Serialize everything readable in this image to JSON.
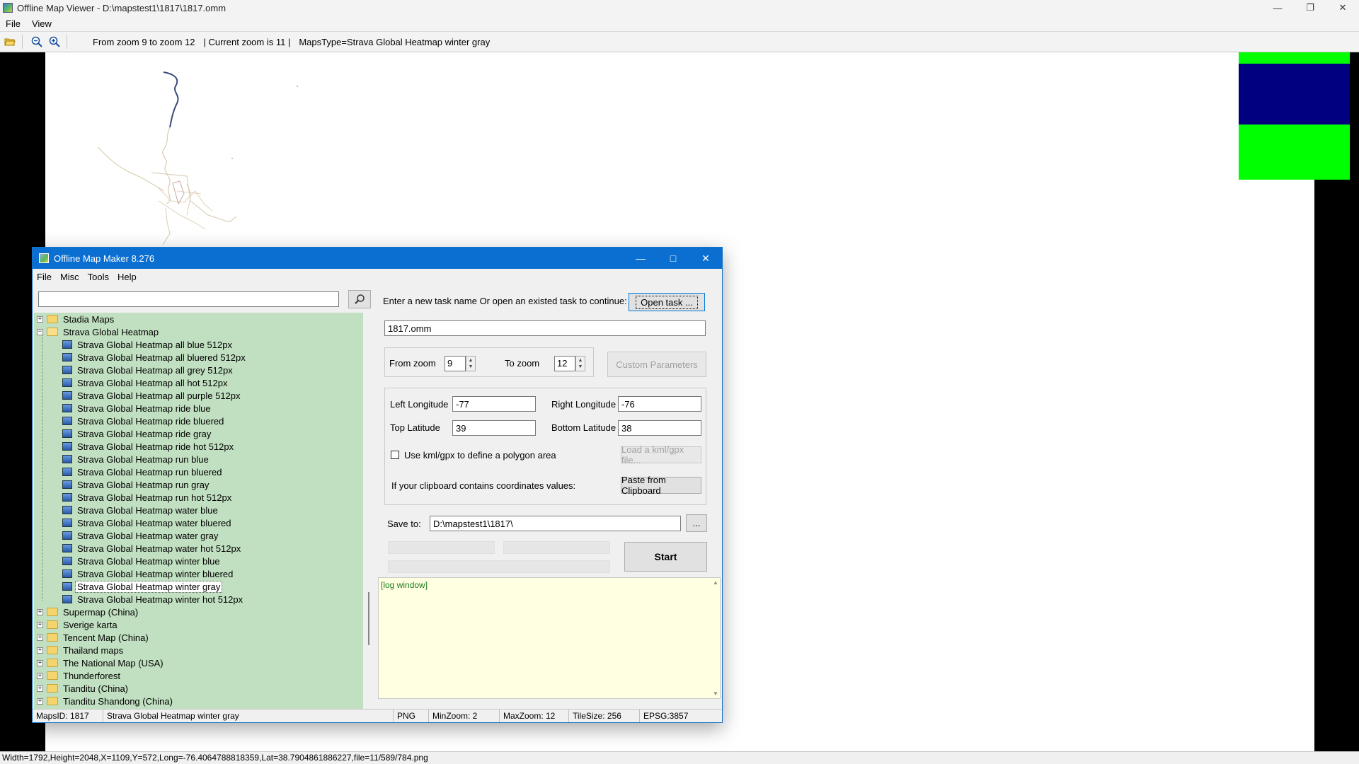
{
  "viewer": {
    "title": "Offline Map Viewer - D:\\mapstest1\\1817\\1817.omm",
    "menu": [
      "File",
      "View"
    ],
    "toolbar": {
      "zoom_range": "From zoom 9 to zoom 12",
      "current_zoom": "|   Current zoom is 11 |",
      "maps_type": "MapsType=Strava Global Heatmap winter gray"
    },
    "status": "Width=1792,Height=2048,X=1109,Y=572,Long=-76.4064788818359,Lat=38.7904861886227,file=11/589/784.png",
    "overview_colors": {
      "green": "#00ff00",
      "navy": "#000080"
    }
  },
  "dialog": {
    "title": "Offline Map Maker 8.276",
    "menu": [
      "File",
      "Misc",
      "Tools",
      "Help"
    ],
    "search": {
      "value": ""
    },
    "tree": [
      {
        "label": "Stadia Maps",
        "type": "folder",
        "expanded": false
      },
      {
        "label": "Strava Global Heatmap",
        "type": "folder",
        "expanded": true
      },
      {
        "label": "Strava Global Heatmap all blue 512px",
        "type": "leaf"
      },
      {
        "label": "Strava Global Heatmap all bluered 512px",
        "type": "leaf"
      },
      {
        "label": "Strava Global Heatmap all grey 512px",
        "type": "leaf"
      },
      {
        "label": "Strava Global Heatmap all hot 512px",
        "type": "leaf"
      },
      {
        "label": "Strava Global Heatmap all purple 512px",
        "type": "leaf"
      },
      {
        "label": "Strava Global Heatmap ride blue",
        "type": "leaf"
      },
      {
        "label": "Strava Global Heatmap ride bluered",
        "type": "leaf"
      },
      {
        "label": "Strava Global Heatmap ride gray",
        "type": "leaf"
      },
      {
        "label": "Strava Global Heatmap ride hot 512px",
        "type": "leaf"
      },
      {
        "label": "Strava Global Heatmap run blue",
        "type": "leaf"
      },
      {
        "label": "Strava Global Heatmap run bluered",
        "type": "leaf"
      },
      {
        "label": "Strava Global Heatmap run gray",
        "type": "leaf"
      },
      {
        "label": "Strava Global Heatmap run hot 512px",
        "type": "leaf"
      },
      {
        "label": "Strava Global Heatmap water blue",
        "type": "leaf"
      },
      {
        "label": "Strava Global Heatmap water bluered",
        "type": "leaf"
      },
      {
        "label": "Strava Global Heatmap water gray",
        "type": "leaf"
      },
      {
        "label": "Strava Global Heatmap water hot 512px",
        "type": "leaf"
      },
      {
        "label": "Strava Global Heatmap winter blue",
        "type": "leaf"
      },
      {
        "label": "Strava Global Heatmap winter bluered",
        "type": "leaf"
      },
      {
        "label": "Strava Global Heatmap winter gray",
        "type": "leaf",
        "selected": true
      },
      {
        "label": "Strava Global Heatmap winter hot 512px",
        "type": "leaf"
      },
      {
        "label": "Supermap (China)",
        "type": "folder",
        "expanded": false
      },
      {
        "label": "Sverige karta",
        "type": "folder",
        "expanded": false
      },
      {
        "label": "Tencent Map (China)",
        "type": "folder",
        "expanded": false
      },
      {
        "label": "Thailand maps",
        "type": "folder",
        "expanded": false
      },
      {
        "label": "The National Map (USA)",
        "type": "folder",
        "expanded": false
      },
      {
        "label": "Thunderforest",
        "type": "folder",
        "expanded": false
      },
      {
        "label": "Tianditu (China)",
        "type": "folder",
        "expanded": false
      },
      {
        "label": "Tianditu Shandong (China)",
        "type": "folder",
        "expanded": false
      }
    ],
    "task": {
      "prompt": "Enter a new task name Or open an existed task to continue:",
      "open_button": "Open task ...",
      "name_value": "1817.omm"
    },
    "zoom": {
      "from_label": "From zoom",
      "from_value": "9",
      "to_label": "To zoom",
      "to_value": "12",
      "custom_button": "Custom Parameters"
    },
    "area": {
      "left_lon_label": "Left Longitude",
      "left_lon_value": "-77",
      "right_lon_label": "Right Longitude",
      "right_lon_value": "-76",
      "top_lat_label": "Top Latitude",
      "top_lat_value": "39",
      "bottom_lat_label": "Bottom Latitude",
      "bottom_lat_value": "38",
      "kml_label": "Use kml/gpx to define a polygon area",
      "kml_checked": false,
      "load_kml_button": "Load a kml/gpx file...",
      "clipboard_label": "If your clipboard contains coordinates values:",
      "paste_button": "Paste from Clipboard"
    },
    "save": {
      "label": "Save to:",
      "value": "D:\\mapstest1\\1817\\",
      "browse_button": "..."
    },
    "start_button": "Start",
    "log_text": "[log window]",
    "status": {
      "maps_id": "MapsID: 1817",
      "maps_name": "Strava Global Heatmap winter gray",
      "format": "PNG",
      "min_zoom": "MinZoom: 2",
      "max_zoom": "MaxZoom: 12",
      "tile_size": "TileSize: 256",
      "epsg": "EPSG:3857"
    }
  }
}
